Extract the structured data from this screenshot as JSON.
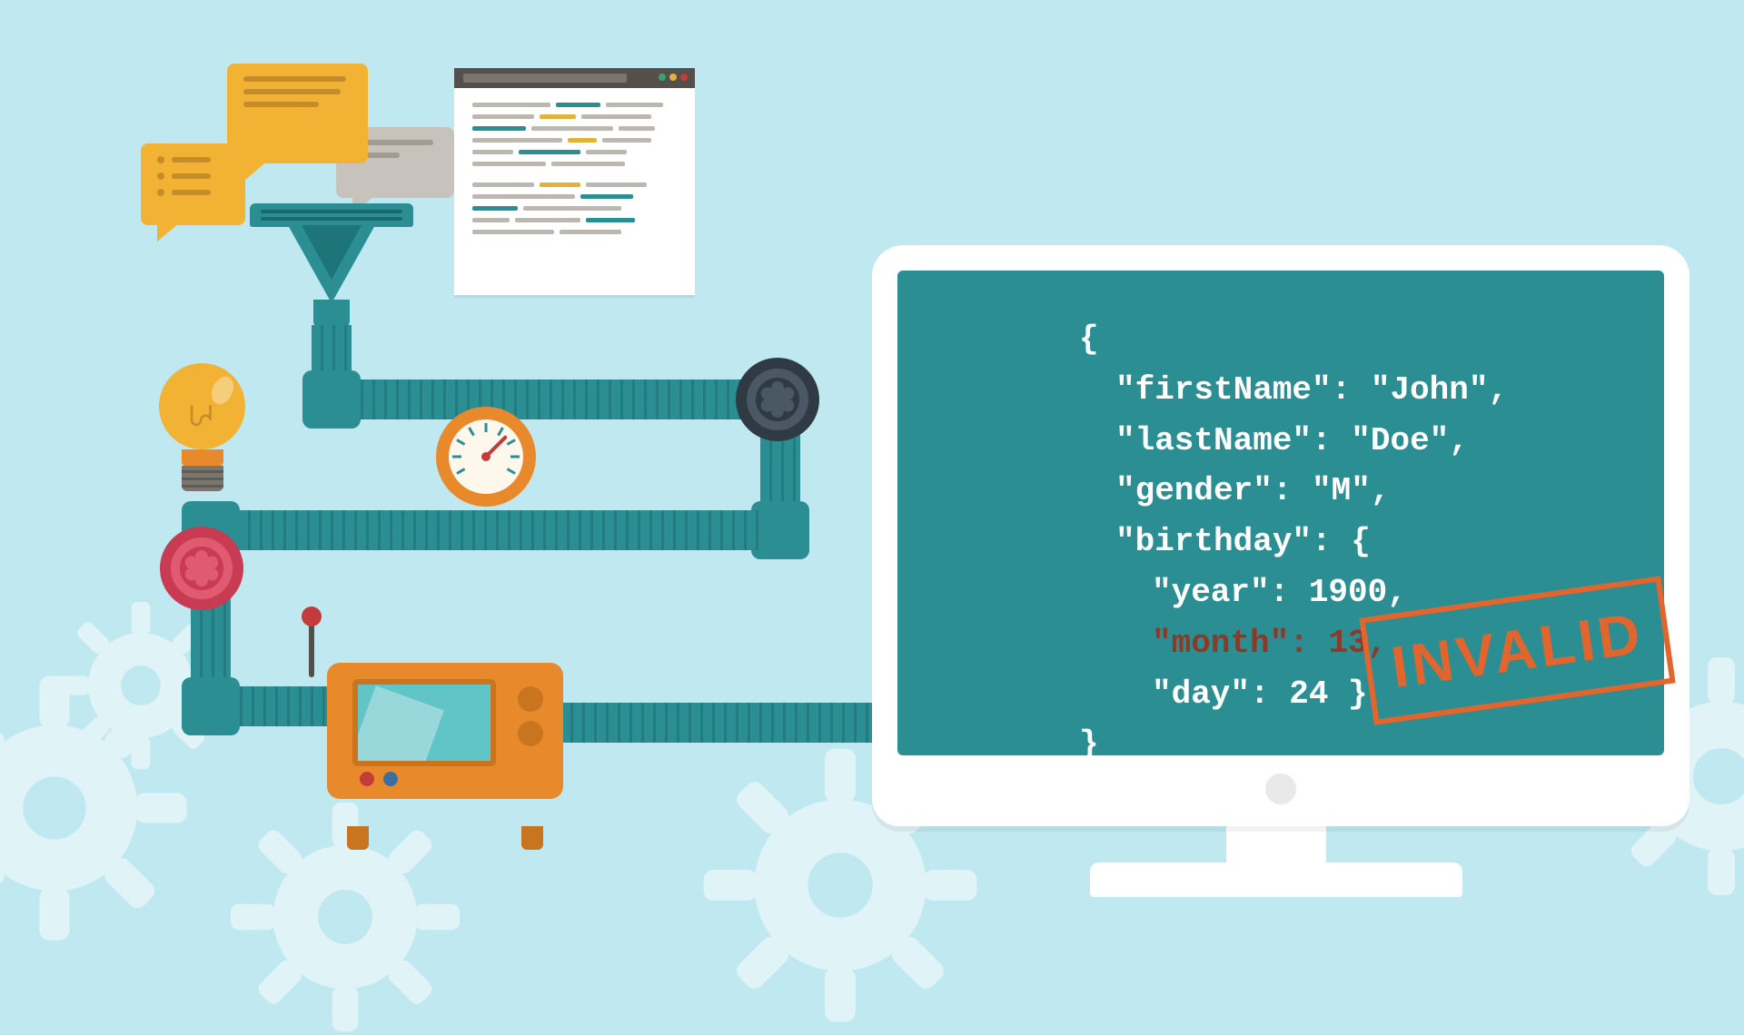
{
  "bubbles": {
    "count": 3
  },
  "document_icon": {
    "lines": 30
  },
  "bulb": {
    "label": "idea-lightbulb"
  },
  "gauge": {
    "label": "pressure-gauge"
  },
  "valves": {
    "dark": "dark-valve",
    "red": "red-valve"
  },
  "machine": {
    "label": "processor-machine"
  },
  "json_output": {
    "open": "{",
    "firstName_key": "\"firstName\"",
    "firstName_val": ": \"John\",",
    "lastName_key": "\"lastName\"",
    "lastName_val": ": \"Doe\",",
    "gender_key": "\"gender\"",
    "gender_val": ": \"M\",",
    "birthday_key": "\"birthday\"",
    "birthday_open": ": {",
    "year_key": "\"year\"",
    "year_val": ": 1900,",
    "month_key": "\"month\"",
    "month_val": ": 13,",
    "day_key": "\"day\"",
    "day_val": ": 24 }",
    "close": "}"
  },
  "stamp": {
    "text": "INVALID"
  },
  "colors": {
    "bg": "#bfe8f0",
    "teal": "#2b8e92",
    "orange": "#e88a2c",
    "amber": "#f2b233",
    "stamp": "#e2652d",
    "error": "#8c3a28"
  }
}
